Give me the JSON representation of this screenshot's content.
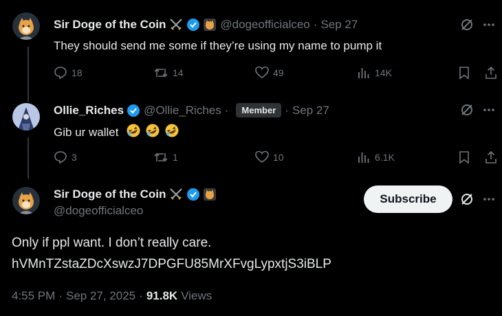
{
  "tweets": [
    {
      "name": "Sir Doge of the Coin",
      "handle": "@dogeofficialceo",
      "date": "Sep 27",
      "text": "They should send me some if they’re using my name to pump it",
      "replies": "18",
      "retweets": "14",
      "likes": "49",
      "views": "14K"
    },
    {
      "name": "Ollie_Riches",
      "handle": "@Ollie_Riches",
      "badge": "Member",
      "date": "Sep 27",
      "text": "Gib ur wallet",
      "emoji": "rolling-on-floor-laughing x3",
      "replies": "3",
      "retweets": "1",
      "likes": "10",
      "views": "6.1K"
    }
  ],
  "main_tweet": {
    "name": "Sir Doge of the Coin",
    "handle": "@dogeofficialceo",
    "subscribe_label": "Subscribe",
    "line1": "Only if ppl want. I don’t really care.",
    "line2": "hVMnTZstaZDcXswzJ7DPGFU85MrXFvgLypxtjS3iBLP",
    "time": "4:55 PM",
    "date": "Sep 27, 2025",
    "views_count": "91.8K",
    "views_label": "Views"
  },
  "colors": {
    "background": "#000000",
    "text": "#e7e9ea",
    "muted": "#71767b",
    "verified": "#1d9bf0",
    "emoji_yellow": "#f5c33b"
  }
}
